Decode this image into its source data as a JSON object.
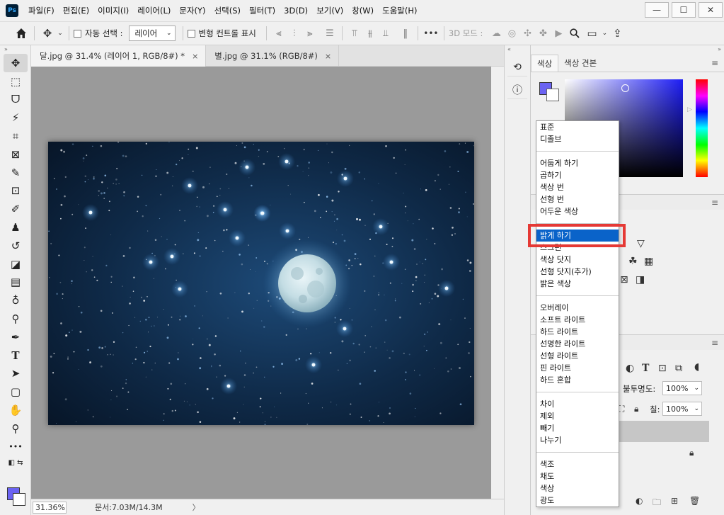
{
  "app": {
    "logo": "Ps"
  },
  "menu": [
    "파일(F)",
    "편집(E)",
    "이미지(I)",
    "레이어(L)",
    "문자(Y)",
    "선택(S)",
    "필터(T)",
    "3D(D)",
    "보기(V)",
    "창(W)",
    "도움말(H)"
  ],
  "window_controls": {
    "minimize": "—",
    "restore": "☐",
    "close": "✕"
  },
  "options": {
    "auto_select_label": "자동 선택 :",
    "auto_select_value": "레이어",
    "transform_label": "변형 컨트롤 표시",
    "more": "•••",
    "mode3d_label": "3D 모드 :"
  },
  "tabs": [
    {
      "label": "달.jpg @ 31.4% (레이어 1, RGB/8#) *",
      "close": "×"
    },
    {
      "label": "별.jpg @ 31.1% (RGB/8#)",
      "close": "×"
    }
  ],
  "status": {
    "zoom": "31.36%",
    "doc": "문서:7.03M/14.3M",
    "arrow": "〉"
  },
  "color_panel": {
    "tabs": [
      "색상",
      "색상 견본"
    ],
    "fg_color": "#6b63f2",
    "bg_color": "#ffffff"
  },
  "layers": {
    "opacity_label": "불투명도:",
    "opacity_value": "100%",
    "fill_label": "칠:",
    "fill_value": "100%"
  },
  "blend_menu": {
    "groups": [
      [
        "표준",
        "디졸브"
      ],
      [
        "어둡게 하기",
        "곱하기",
        "색상 번",
        "선형 번",
        "어두운 색상"
      ],
      [
        "밝게 하기",
        "스크린",
        "색상 닷지",
        "선형 닷지(추가)",
        "밝은 색상"
      ],
      [
        "오버레이",
        "소프트 라이트",
        "하드 라이트",
        "선명한 라이트",
        "선형 라이트",
        "핀 라이트",
        "하드 혼합"
      ],
      [
        "차이",
        "제외",
        "빼기",
        "나누기"
      ],
      [
        "색조",
        "채도",
        "색상",
        "광도"
      ]
    ],
    "selected": "밝게 하기"
  },
  "accent": {
    "highlight_border": "#e53935",
    "selection": "#0a63c9"
  }
}
